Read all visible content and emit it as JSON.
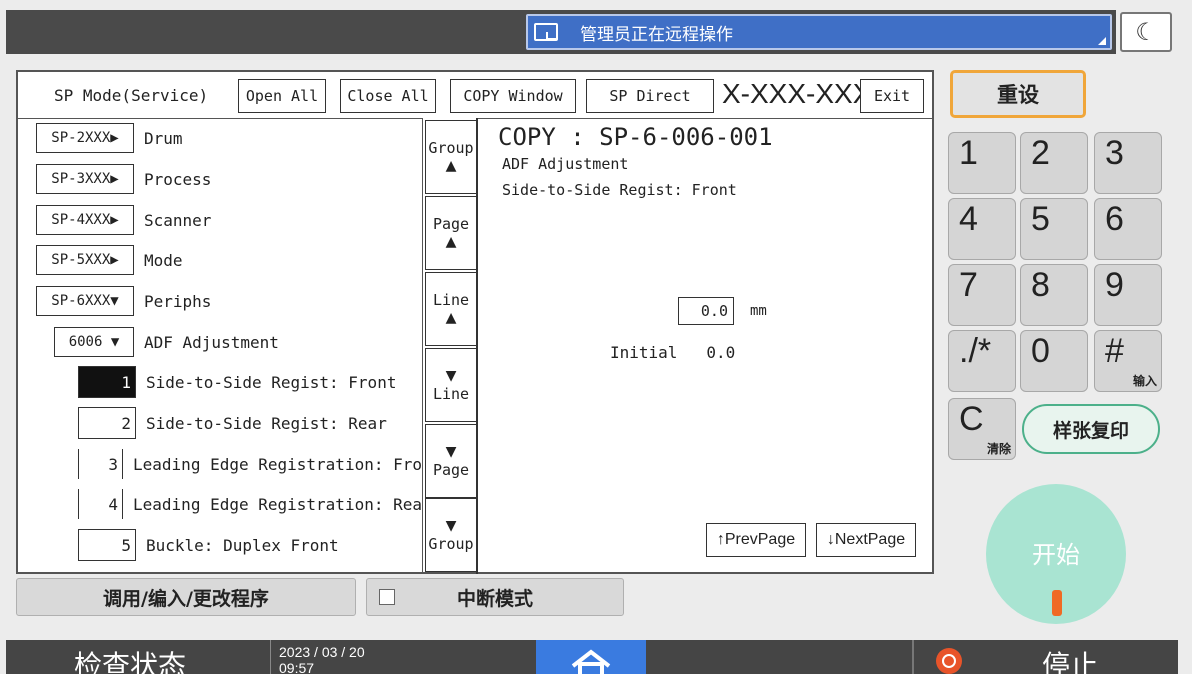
{
  "top": {
    "remote_text": "管理员正在远程操作",
    "moon_glyph": "☾"
  },
  "sp": {
    "title": "SP Mode(Service)",
    "open_all": "Open All",
    "close_all": "Close All",
    "copy_window": "COPY Window",
    "sp_direct": "SP Direct",
    "model": "X-XXX-XXX",
    "exit": "Exit",
    "groups": [
      {
        "code": "SP-2XXX▶",
        "label": "Drum"
      },
      {
        "code": "SP-3XXX▶",
        "label": "Process"
      },
      {
        "code": "SP-4XXX▶",
        "label": "Scanner"
      },
      {
        "code": "SP-5XXX▶",
        "label": "Mode"
      },
      {
        "code": "SP-6XXX▼",
        "label": "Periphs"
      }
    ],
    "subgroup": {
      "code": "6006 ▼",
      "label": "ADF Adjustment"
    },
    "items": [
      {
        "num": "1",
        "label": "Side-to-Side Regist: Front"
      },
      {
        "num": "2",
        "label": "Side-to-Side Regist: Rear"
      },
      {
        "num": "3",
        "label": "Leading Edge Registration: Fro"
      },
      {
        "num": "4",
        "label": "Leading Edge Registration: Rea"
      },
      {
        "num": "5",
        "label": "Buckle: Duplex Front"
      }
    ],
    "nav": {
      "group_up": "Group",
      "page_up": "Page",
      "line_up": "Line",
      "line_down": "Line",
      "page_down": "Page",
      "group_down": "Group",
      "up_arrow": "▲",
      "down_arrow": "▼"
    },
    "detail": {
      "code": "COPY : SP-6-006-001",
      "sub1": "ADF Adjustment",
      "sub2": "Side-to-Side Regist: Front",
      "value": "0.0",
      "unit": "mm",
      "initial_label": "Initial",
      "initial_value": "0.0",
      "prev_page": "↑PrevPage",
      "next_page": "↓NextPage"
    }
  },
  "bottom_buttons": {
    "program": "调用/编入/更改程序",
    "interrupt": "中断模式"
  },
  "keypad": {
    "reset": "重设",
    "keys": [
      "1",
      "2",
      "3",
      "4",
      "5",
      "6",
      "7",
      "8",
      "9",
      "./*",
      "0",
      "#"
    ],
    "hash_sub": "输入",
    "clear": "C",
    "clear_sub": "清除",
    "sample_copy": "样张复印",
    "start": "开始"
  },
  "status_bar": {
    "check_status": "检查状态",
    "date": "2023 / 03 / 20",
    "time": "09:57",
    "stop": "停止"
  }
}
